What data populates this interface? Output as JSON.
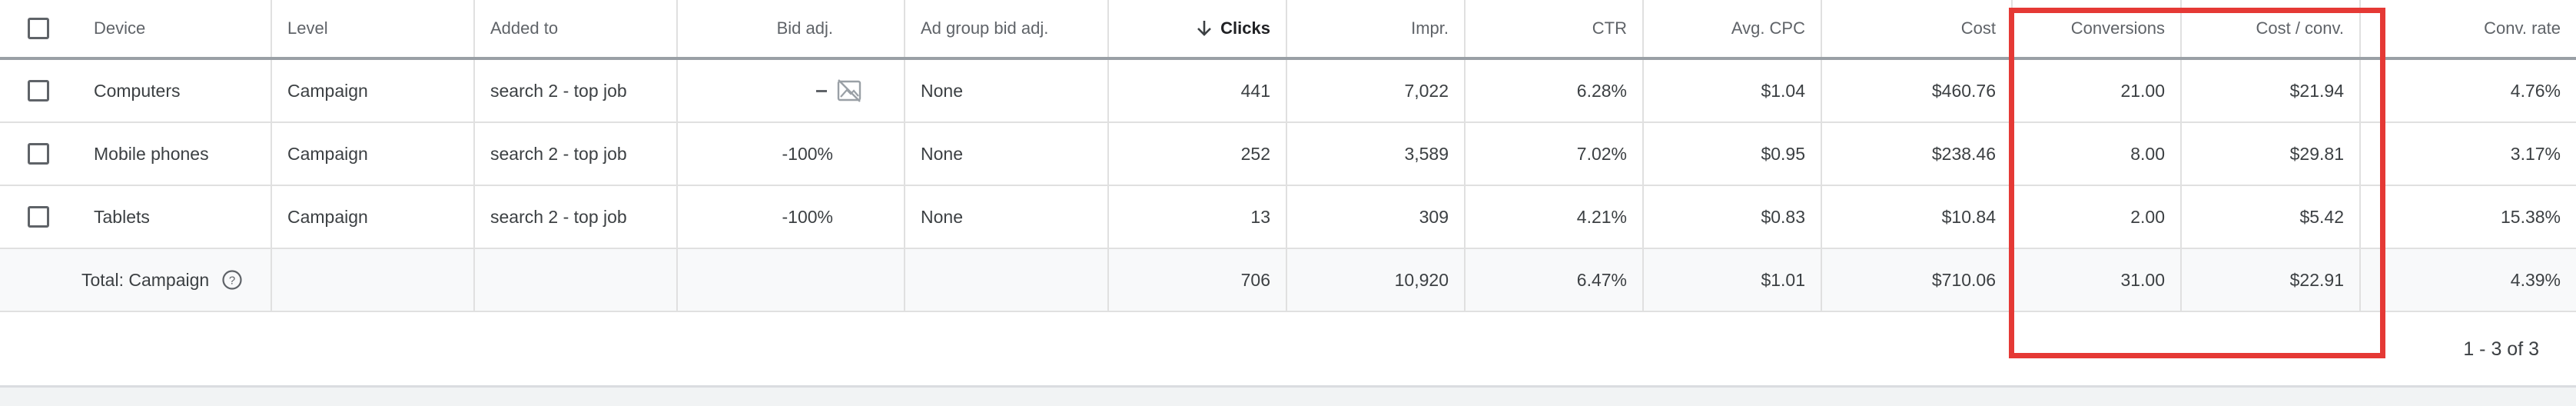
{
  "columns": {
    "device": "Device",
    "level": "Level",
    "added_to": "Added to",
    "bid_adj": "Bid adj.",
    "ad_group_bid_adj": "Ad group bid adj.",
    "clicks": "Clicks",
    "impr": "Impr.",
    "ctr": "CTR",
    "avg_cpc": "Avg. CPC",
    "cost": "Cost",
    "conversions": "Conversions",
    "cost_per_conv": "Cost / conv.",
    "conv_rate": "Conv. rate"
  },
  "sort": {
    "column": "clicks",
    "direction": "descending",
    "icon": "arrow-down-icon"
  },
  "rows": [
    {
      "device": "Computers",
      "level": "Campaign",
      "added_to": "search 2 - top job",
      "bid_adj": "",
      "bid_adj_icons": [
        "dash-icon",
        "image-placeholder-icon"
      ],
      "ad_group_bid_adj": "None",
      "clicks": "441",
      "impr": "7,022",
      "ctr": "6.28%",
      "avg_cpc": "$1.04",
      "cost": "$460.76",
      "conversions": "21.00",
      "cost_per_conv": "$21.94",
      "conv_rate": "4.76%"
    },
    {
      "device": "Mobile phones",
      "level": "Campaign",
      "added_to": "search 2 - top job",
      "bid_adj": "-100%",
      "ad_group_bid_adj": "None",
      "clicks": "252",
      "impr": "3,589",
      "ctr": "7.02%",
      "avg_cpc": "$0.95",
      "cost": "$238.46",
      "conversions": "8.00",
      "cost_per_conv": "$29.81",
      "conv_rate": "3.17%"
    },
    {
      "device": "Tablets",
      "level": "Campaign",
      "added_to": "search 2 - top job",
      "bid_adj": "-100%",
      "ad_group_bid_adj": "None",
      "clicks": "13",
      "impr": "309",
      "ctr": "4.21%",
      "avg_cpc": "$0.83",
      "cost": "$10.84",
      "conversions": "2.00",
      "cost_per_conv": "$5.42",
      "conv_rate": "15.38%"
    }
  ],
  "total": {
    "label": "Total: Campaign",
    "help_icon": "help-circle-icon",
    "clicks": "706",
    "impr": "10,920",
    "ctr": "6.47%",
    "avg_cpc": "$1.01",
    "cost": "$710.06",
    "conversions": "31.00",
    "cost_per_conv": "$22.91",
    "conv_rate": "4.39%"
  },
  "pagination": "1 - 3 of 3",
  "colors": {
    "highlight": "#e53935",
    "total_bg": "#f8f9fa",
    "border": "#e0e0e0"
  }
}
